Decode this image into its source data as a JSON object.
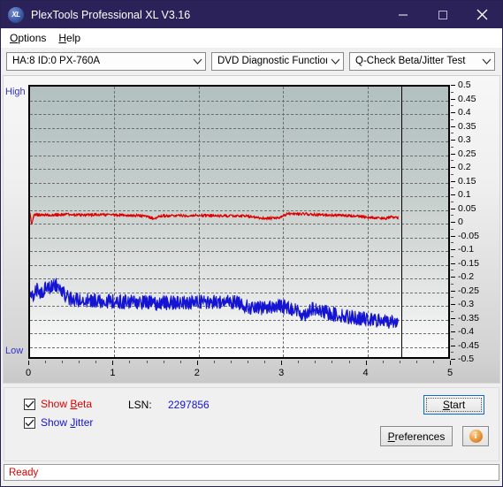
{
  "window": {
    "title": "PlexTools Professional XL V3.16",
    "icon": "xl-logo-icon",
    "minimize": "minimize-icon",
    "maximize": "maximize-icon",
    "close": "close-icon"
  },
  "menubar": {
    "items": [
      {
        "label": "Options",
        "accel": "O"
      },
      {
        "label": "Help",
        "accel": "H"
      }
    ]
  },
  "toolbar": {
    "drive_select": {
      "value": "HA:8 ID:0  PX-760A",
      "icon": "chevron-down-icon"
    },
    "function_select": {
      "value": "DVD Diagnostic Functions",
      "icon": "chevron-down-icon"
    },
    "test_select": {
      "value": "Q-Check Beta/Jitter Test",
      "icon": "chevron-down-icon"
    }
  },
  "chart_labels": {
    "high": "High",
    "low": "Low"
  },
  "controls": {
    "show_beta": {
      "label_pre": "Show ",
      "label_accel": "B",
      "label_post": "eta",
      "checked": true,
      "color": "#e00000"
    },
    "show_jitter": {
      "label_pre": "Show ",
      "label_accel": "J",
      "label_post": "itter",
      "checked": true,
      "color": "#1414d2"
    },
    "lsn_label": "LSN:",
    "lsn_value": "2297856",
    "start_button": {
      "pre": "",
      "accel": "S",
      "post": "tart",
      "focused": true
    },
    "preferences_button": {
      "pre": "",
      "accel": "P",
      "post": "references"
    },
    "info_button": {
      "icon": "info-icon",
      "glyph": "i"
    }
  },
  "statusbar": {
    "text": "Ready"
  },
  "colors": {
    "titlebar": "#2b2259",
    "beta": "#e00000",
    "jitter": "#1414d2",
    "plot_top": "#b2c0c0",
    "plot_bottom": "#fdfdfd",
    "grid": "#6d6d6d",
    "accent": "#0a6cd0"
  },
  "chart_data": {
    "type": "line",
    "title": "Q-Check Beta/Jitter Test",
    "xlabel": "",
    "ylabel": "",
    "xlim": [
      0,
      5
    ],
    "ylim": [
      -0.5,
      0.5
    ],
    "grid": true,
    "legend_position": "bottom-left",
    "y_right_ticks": [
      0.5,
      0.45,
      0.4,
      0.35,
      0.3,
      0.25,
      0.2,
      0.15,
      0.1,
      0.05,
      0,
      -0.05,
      -0.1,
      -0.15,
      -0.2,
      -0.25,
      -0.3,
      -0.35,
      -0.4,
      -0.45,
      -0.5
    ],
    "y_left_ticks": [
      "High",
      "Low"
    ],
    "x_ticks": [
      0,
      1,
      2,
      3,
      4,
      5
    ],
    "data_end_x": 4.4,
    "series": [
      {
        "name": "Beta",
        "color": "#e00000",
        "x": [
          0.0,
          0.02,
          0.05,
          0.09,
          0.15,
          0.22,
          0.3,
          0.4,
          0.52,
          0.65,
          0.8,
          0.95,
          1.1,
          1.25,
          1.4,
          1.48,
          1.55,
          1.7,
          1.85,
          2.0,
          2.15,
          2.3,
          2.45,
          2.6,
          2.75,
          2.9,
          3.0,
          3.08,
          3.15,
          3.3,
          3.45,
          3.6,
          3.75,
          3.9,
          4.05,
          4.15,
          4.25,
          4.32,
          4.38,
          4.4
        ],
        "y": [
          0.03,
          -0.01,
          0.028,
          0.026,
          0.027,
          0.025,
          0.026,
          0.027,
          0.026,
          0.025,
          0.026,
          0.026,
          0.025,
          0.024,
          0.02,
          0.012,
          0.022,
          0.023,
          0.023,
          0.024,
          0.023,
          0.022,
          0.022,
          0.021,
          0.014,
          0.013,
          0.016,
          0.03,
          0.03,
          0.029,
          0.026,
          0.025,
          0.023,
          0.021,
          0.017,
          0.014,
          0.012,
          0.018,
          0.016,
          0.016
        ],
        "noise_amplitude": 0.006
      },
      {
        "name": "Jitter",
        "color": "#1414d2",
        "x": [
          0.0,
          0.04,
          0.08,
          0.13,
          0.18,
          0.24,
          0.3,
          0.34,
          0.38,
          0.42,
          0.46,
          0.5,
          0.6,
          0.75,
          0.9,
          1.05,
          1.2,
          1.35,
          1.45,
          1.52,
          1.6,
          1.75,
          1.9,
          2.05,
          2.2,
          2.35,
          2.5,
          2.62,
          2.7,
          2.85,
          3.0,
          3.1,
          3.2,
          3.28,
          3.35,
          3.45,
          3.6,
          3.75,
          3.9,
          4.05,
          4.2,
          4.32,
          4.38,
          4.4
        ],
        "y": [
          -0.255,
          -0.272,
          -0.25,
          -0.268,
          -0.248,
          -0.238,
          -0.232,
          -0.245,
          -0.252,
          -0.268,
          -0.282,
          -0.288,
          -0.29,
          -0.292,
          -0.293,
          -0.295,
          -0.296,
          -0.298,
          -0.3,
          -0.302,
          -0.3,
          -0.298,
          -0.297,
          -0.297,
          -0.296,
          -0.296,
          -0.297,
          -0.318,
          -0.322,
          -0.315,
          -0.312,
          -0.316,
          -0.33,
          -0.345,
          -0.322,
          -0.33,
          -0.34,
          -0.348,
          -0.355,
          -0.362,
          -0.368,
          -0.368,
          -0.37,
          -0.372
        ],
        "noise_amplitude": 0.03
      }
    ]
  }
}
